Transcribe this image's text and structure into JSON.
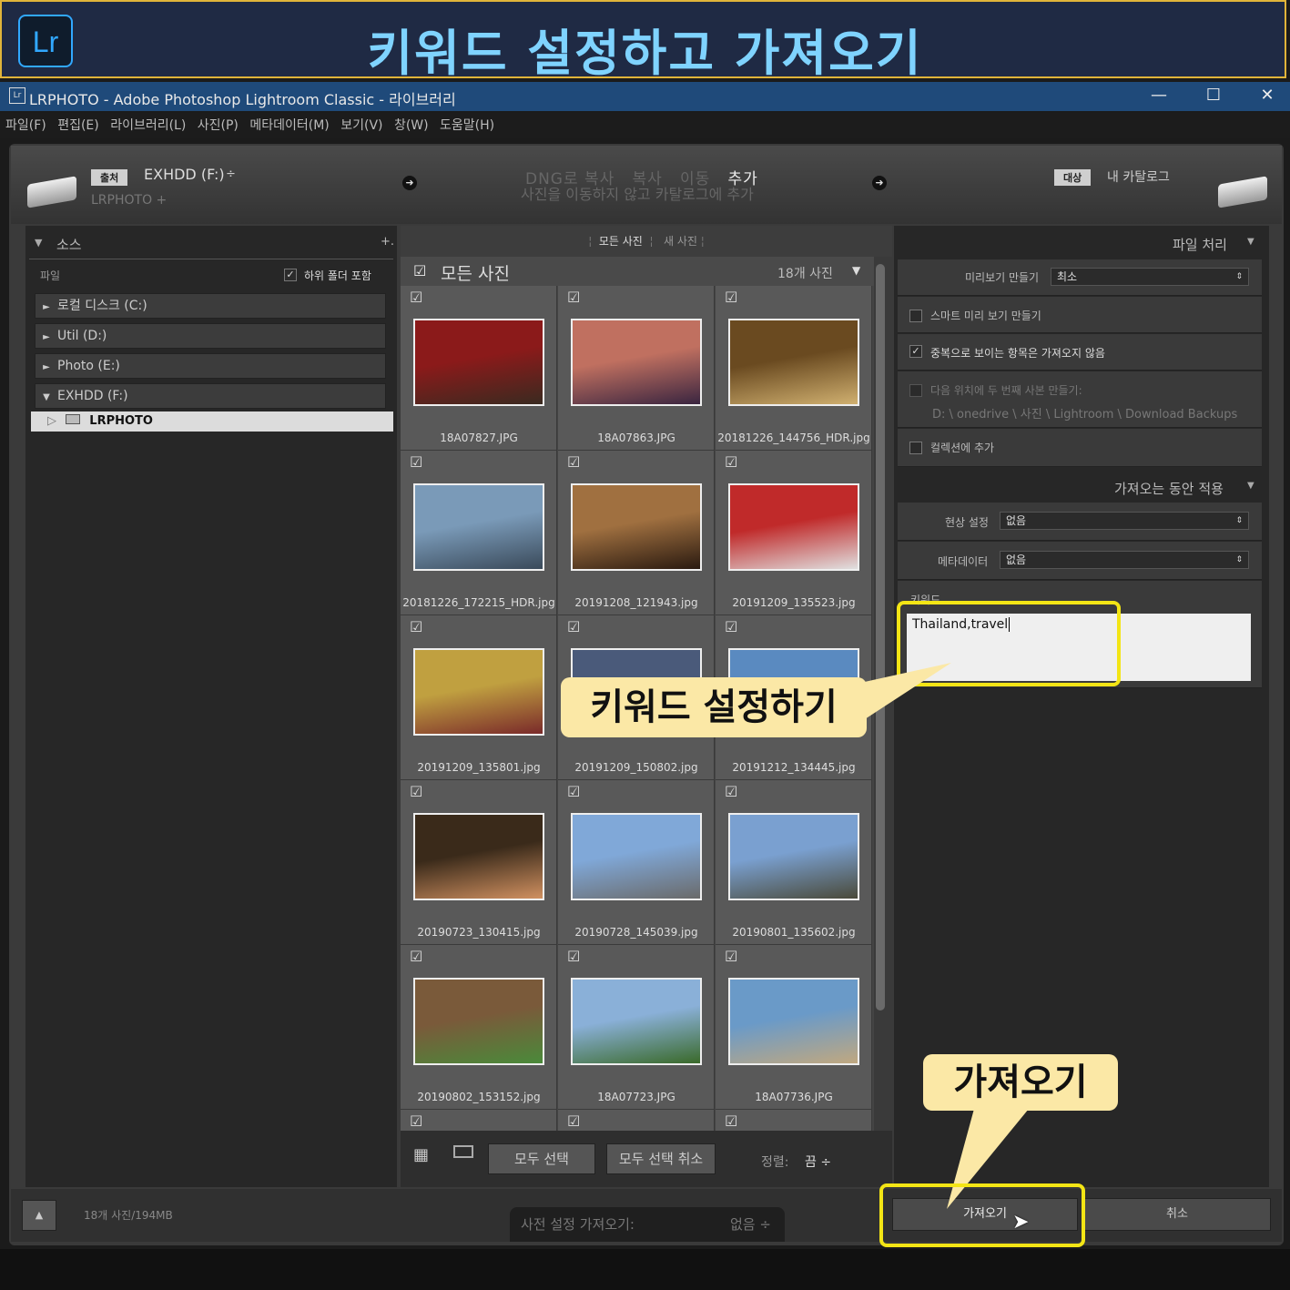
{
  "banner": {
    "logo": "Lr",
    "title": "키워드 설정하고 가져오기"
  },
  "window": {
    "icon": "Lr",
    "title": "LRPHOTO - Adobe Photoshop Lightroom Classic - 라이브러리",
    "minimize": "—",
    "maximize": "☐",
    "close": "✕"
  },
  "menu": [
    "파일(F)",
    "편집(E)",
    "라이브러리(L)",
    "사진(P)",
    "메타데이터(M)",
    "보기(V)",
    "창(W)",
    "도움말(H)"
  ],
  "source_header": {
    "tag": "출처",
    "drive": "EXHDD (F:)",
    "drive_arrow": "÷",
    "path": "LRPHOTO +"
  },
  "modes": {
    "items": [
      "DNG로 복사",
      "복사",
      "이동",
      "추가"
    ],
    "active": "추가",
    "subtitle": "사진을 이동하지 않고 카탈로그에 추가"
  },
  "dest_header": {
    "tag": "대상",
    "label": "내 카탈로그"
  },
  "left": {
    "title": "소스",
    "plus": "+.",
    "files_label": "파일",
    "subfolders": "하위 폴더 포함",
    "drives": [
      {
        "label": "로컬 디스크 (C:)",
        "tri": "►"
      },
      {
        "label": "Util (D:)",
        "tri": "►"
      },
      {
        "label": "Photo (E:)",
        "tri": "►"
      },
      {
        "label": "EXHDD (F:)",
        "tri": "▼"
      }
    ],
    "folder": "LRPHOTO"
  },
  "grid": {
    "tabs": [
      "모든 사진",
      "새 사진"
    ],
    "header_title": "모든 사진",
    "count": "18개 사진",
    "files": [
      "18A07827.JPG",
      "18A07863.JPG",
      "20181226_144756_HDR.jpg",
      "20181226_172215_HDR.jpg",
      "20191208_121943.jpg",
      "20191209_135523.jpg",
      "20191209_135801.jpg",
      "20191209_150802.jpg",
      "20191212_134445.jpg",
      "20190723_130415.jpg",
      "20190728_145039.jpg",
      "20190801_135602.jpg",
      "20190802_153152.jpg",
      "18A07723.JPG",
      "18A07736.JPG"
    ],
    "check_all": "모두 선택",
    "uncheck_all": "모두 선택 취소",
    "sort_label": "정렬:",
    "sort_value": "끔 ÷"
  },
  "right": {
    "file_handling": "파일 처리",
    "preview_label": "미리보기 만들기",
    "preview_value": "최소",
    "smart_preview": "스마트 미리 보기 만들기",
    "no_duplicates": "중복으로 보이는 항목은 가져오지 않음",
    "second_copy": "다음 위치에 두 번째 사본 만들기:",
    "second_copy_path": "D: \\ onedrive \\ 사진 \\ Lightroom \\ Download Backups",
    "add_to_collection": "컬렉션에 추가",
    "apply_during": "가져오는 동안 적용",
    "develop_label": "현상 설정",
    "develop_value": "없음",
    "metadata_label": "메타데이터",
    "metadata_value": "없음",
    "keywords_label": "키워드",
    "keywords_value": "Thailand,travel"
  },
  "bottom": {
    "summary": "18개 사진/194MB",
    "preset_label": "사전 설정 가져오기:",
    "preset_value": "없음 ÷",
    "import": "가져오기",
    "cancel": "취소"
  },
  "callouts": {
    "keyword": "키워드 설정하기",
    "import": "가져오기"
  }
}
